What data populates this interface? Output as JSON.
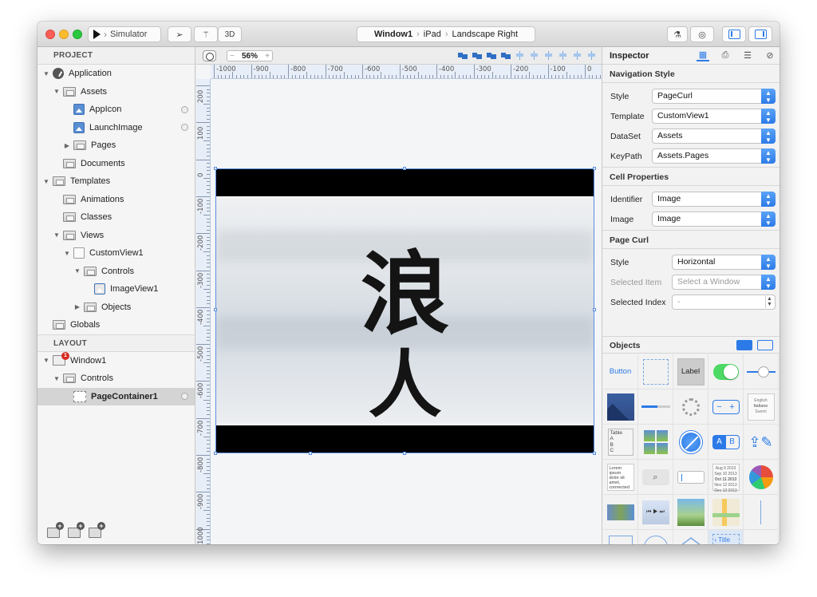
{
  "toolbar": {
    "scheme_label": "Simulator",
    "mode_3d": "3D",
    "path": {
      "window": "Window1",
      "device": "iPad",
      "orientation": "Landscape Right"
    }
  },
  "project": {
    "header": "PROJECT",
    "items": [
      {
        "label": "Application",
        "depth": 0,
        "disclosure": "open",
        "icon": "app-icon"
      },
      {
        "label": "Assets",
        "depth": 1,
        "disclosure": "open",
        "icon": "folder-icon"
      },
      {
        "label": "AppIcon",
        "depth": 2,
        "disclosure": "none",
        "icon": "image-icon"
      },
      {
        "label": "LaunchImage",
        "depth": 2,
        "disclosure": "none",
        "icon": "image-icon"
      },
      {
        "label": "Pages",
        "depth": 2,
        "disclosure": "closed",
        "icon": "folder-icon"
      },
      {
        "label": "Documents",
        "depth": 1,
        "disclosure": "none",
        "icon": "folder-icon"
      },
      {
        "label": "Templates",
        "depth": 0,
        "disclosure": "open",
        "icon": "folder-icon"
      },
      {
        "label": "Animations",
        "depth": 1,
        "disclosure": "none",
        "icon": "folder-icon"
      },
      {
        "label": "Classes",
        "depth": 1,
        "disclosure": "none",
        "icon": "folder-icon"
      },
      {
        "label": "Views",
        "depth": 1,
        "disclosure": "open",
        "icon": "folder-icon"
      },
      {
        "label": "CustomView1",
        "depth": 2,
        "disclosure": "open",
        "icon": "view-icon"
      },
      {
        "label": "Controls",
        "depth": 3,
        "disclosure": "open",
        "icon": "folder-icon"
      },
      {
        "label": "ImageView1",
        "depth": 4,
        "disclosure": "none",
        "icon": "imageview-icon"
      },
      {
        "label": "Objects",
        "depth": 3,
        "disclosure": "closed",
        "icon": "folder-icon"
      },
      {
        "label": "Globals",
        "depth": 0,
        "disclosure": "none",
        "icon": "folder-icon"
      }
    ]
  },
  "layout": {
    "header": "LAYOUT",
    "items": [
      {
        "label": "Window1",
        "depth": 0,
        "disclosure": "open",
        "icon": "window-icon",
        "badge": "1"
      },
      {
        "label": "Controls",
        "depth": 1,
        "disclosure": "open",
        "icon": "folder-icon"
      },
      {
        "label": "PageContainer1",
        "depth": 2,
        "disclosure": "none",
        "icon": "page-container-icon",
        "selected": true
      }
    ]
  },
  "canvas": {
    "zoom": "56%",
    "ruler_top": [
      "-1000",
      "-900",
      "-800",
      "-700",
      "-600",
      "-500",
      "-400",
      "-300",
      "-200",
      "-100",
      "0"
    ],
    "ruler_left": [
      "200",
      "100",
      "0",
      "-100",
      "-200",
      "-300",
      "-400",
      "-500",
      "-600",
      "-700",
      "-800",
      "-900",
      "-1000"
    ],
    "artwork_text": [
      "浪",
      "人"
    ]
  },
  "inspector": {
    "title": "Inspector",
    "navigation_style": {
      "title": "Navigation Style",
      "style_label": "Style",
      "style_value": "PageCurl",
      "template_label": "Template",
      "template_value": "CustomView1",
      "dataset_label": "DataSet",
      "dataset_value": "Assets",
      "keypath_label": "KeyPath",
      "keypath_value": "Assets.Pages"
    },
    "cell_properties": {
      "title": "Cell Properties",
      "identifier_label": "Identifier",
      "identifier_value": "Image",
      "image_label": "Image",
      "image_value": "Image"
    },
    "page_curl": {
      "title": "Page Curl",
      "style_label": "Style",
      "style_value": "Horizontal",
      "selected_item_label": "Selected Item",
      "selected_item_placeholder": "Select a Window",
      "selected_index_label": "Selected Index",
      "selected_index_value": "-"
    },
    "objects": {
      "title": "Objects",
      "button_label": "Button",
      "label_label": "Label",
      "picker_lines": [
        "English",
        "Italiano",
        "Suomi"
      ],
      "table_lines": [
        "Table",
        "A",
        "B",
        "C"
      ],
      "segment": [
        "A",
        "B"
      ],
      "text_sample": "Lorem ipsum dolor sit amet, connected",
      "date_lines": [
        "Aug 9 2013",
        "Sep 10 2013",
        "Oct 11 2013",
        "Nov 12 2013",
        "Dec 13 2013"
      ],
      "nav_title": "Title"
    }
  }
}
